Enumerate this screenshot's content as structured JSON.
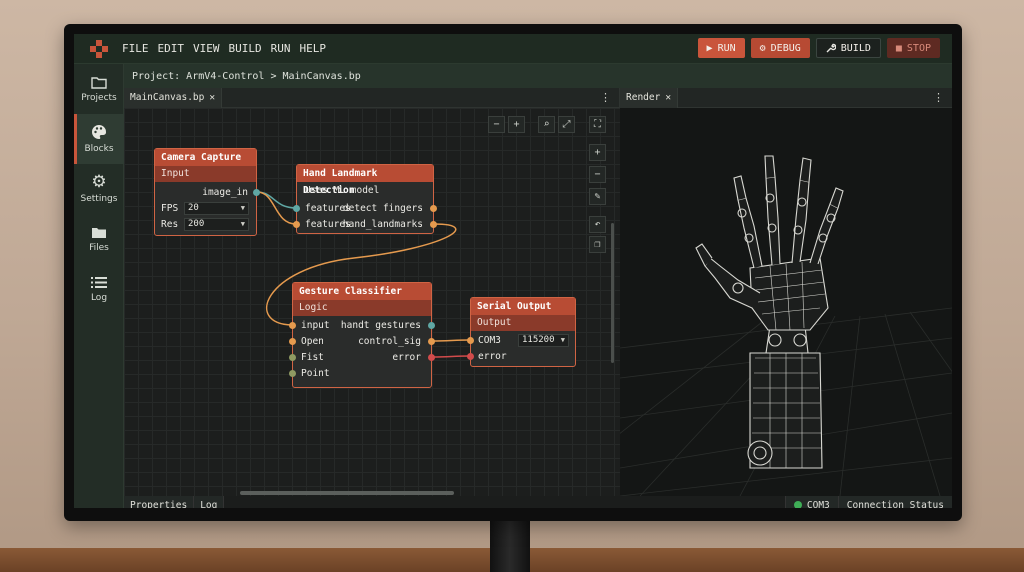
{
  "menubar": {
    "items": [
      "FILE",
      "EDIT",
      "VIEW",
      "BUILD",
      "RUN",
      "HELP"
    ],
    "buttons": {
      "run": "RUN",
      "debug": "DEBUG",
      "build": "BUILD",
      "stop": "STOP"
    }
  },
  "sidebar": {
    "items": [
      {
        "label": "Projects",
        "icon": "folder-icon"
      },
      {
        "label": "Blocks",
        "icon": "palette-icon"
      },
      {
        "label": "Settings",
        "icon": "gear-icon"
      },
      {
        "label": "Files",
        "icon": "folder-icon"
      },
      {
        "label": "Log",
        "icon": "list-icon"
      }
    ],
    "active": "Blocks"
  },
  "breadcrumb": {
    "project": "Project: ArmV4-Control",
    "separator": ">",
    "file": "MainCanvas.bp"
  },
  "editor": {
    "tab": "MainCanvas.bp"
  },
  "render": {
    "tab": "Render"
  },
  "nodes": {
    "camera": {
      "title": "Camera Capture",
      "subtitle": "Input",
      "out": "image_in",
      "fps_label": "FPS",
      "fps_value": "20",
      "res_label": "Res",
      "res_value": "200"
    },
    "hand": {
      "title": "Hand Landmark Detection",
      "desc": "Uses ML model",
      "in1": "features",
      "out1": "detect fingers",
      "in2": "features",
      "out2": "hand_landmarks"
    },
    "gesture": {
      "title": "Gesture Classifier",
      "subtitle": "Logic",
      "in1": "input",
      "out1": "handt gestures",
      "in2": "Open",
      "out2": "control_sig",
      "in3": "Fist",
      "out3": "error",
      "in4": "Point"
    },
    "serial": {
      "title": "Serial Output",
      "subtitle": "Output",
      "port": "COM3",
      "baud": "115200",
      "in2": "error"
    }
  },
  "bottom_tabs": [
    "Properties",
    "Log"
  ],
  "status": {
    "port": "COM3",
    "connection": "Connection Status"
  },
  "colors": {
    "accent": "#c9553b",
    "status_ok": "#3fae57"
  }
}
